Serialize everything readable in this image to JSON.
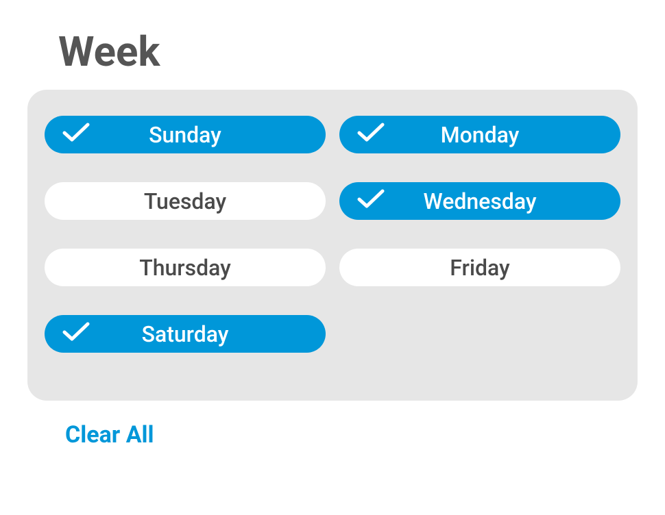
{
  "title": "Week",
  "days": [
    {
      "label": "Sunday",
      "selected": true
    },
    {
      "label": "Monday",
      "selected": true
    },
    {
      "label": "Tuesday",
      "selected": false
    },
    {
      "label": "Wednesday",
      "selected": true
    },
    {
      "label": "Thursday",
      "selected": false
    },
    {
      "label": "Friday",
      "selected": false
    },
    {
      "label": "Saturday",
      "selected": true
    }
  ],
  "clear_all_label": "Clear All",
  "colors": {
    "accent": "#0097d9",
    "panel": "#e6e6e6",
    "text": "#4a4a4a"
  }
}
